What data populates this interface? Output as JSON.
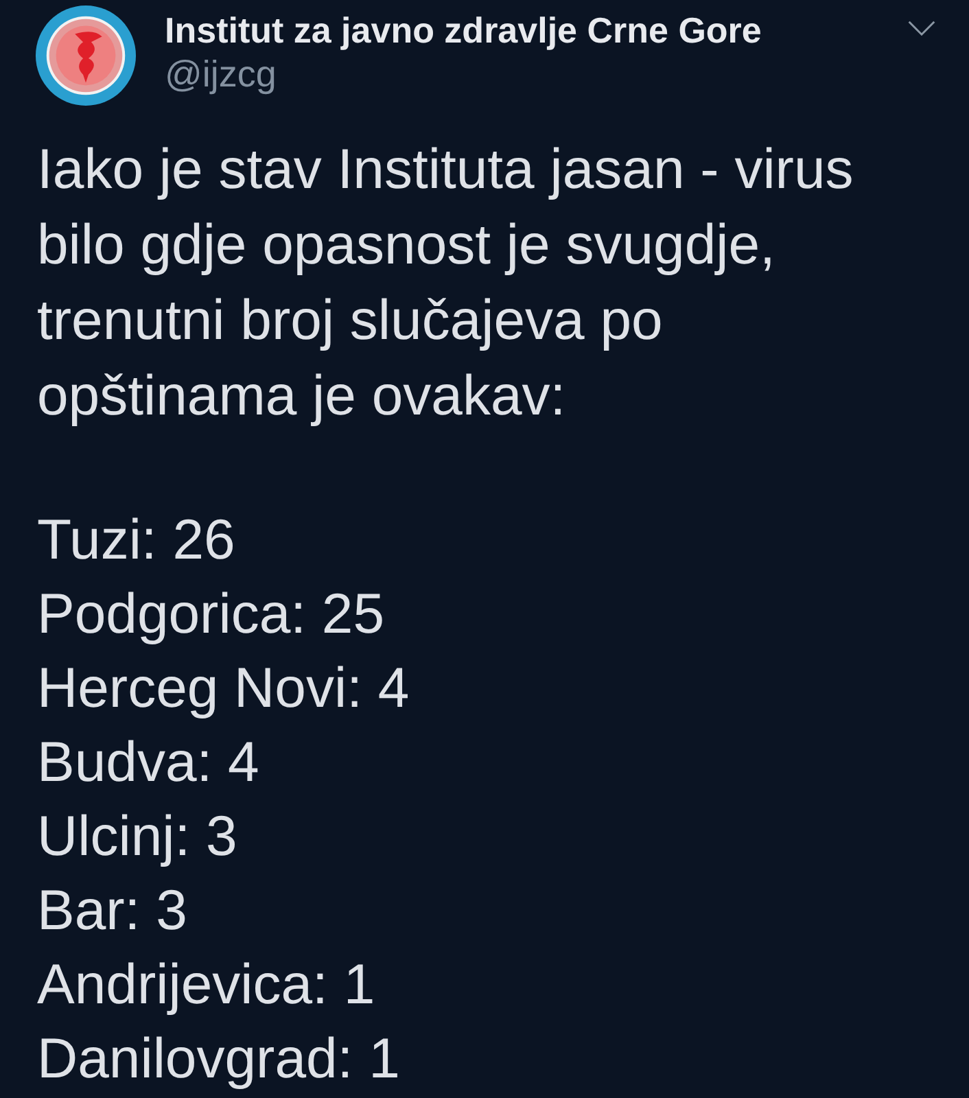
{
  "tweet": {
    "author": {
      "name": "Institut za javno zdravlje Crne Gore",
      "handle": "@ijzcg"
    },
    "text_lines": [
      "Iako je stav Instituta jasan - virus",
      "bilo gdje opasnost je svugdje,",
      "trenutni broj slučajeva po",
      "opštinama je ovakav:"
    ],
    "case_lines": [
      "Tuzi: 26",
      "Podgorica: 25",
      "Herceg Novi: 4",
      "Budva: 4",
      "Ulcinj: 3",
      "Bar: 3",
      "Andrijevica: 1",
      "Danilovgrad: 1"
    ]
  }
}
